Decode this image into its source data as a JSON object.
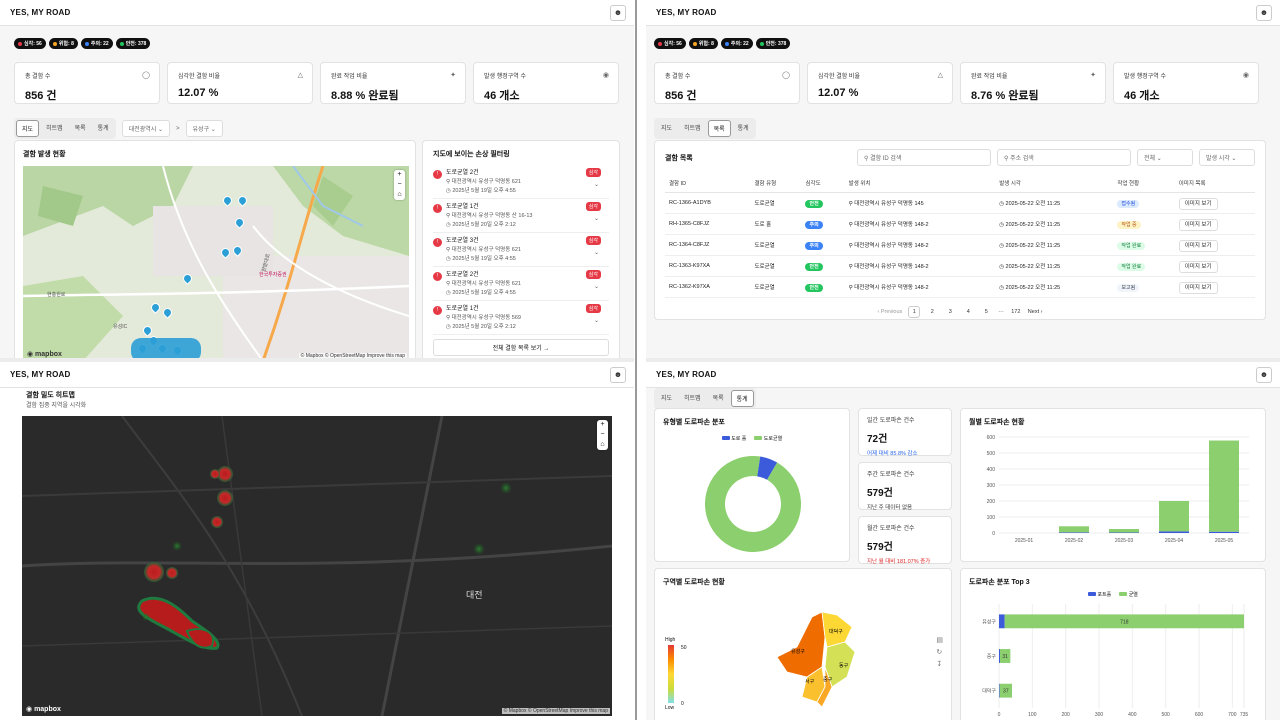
{
  "app": {
    "brand": "YES, MY ROAD"
  },
  "badges": [
    {
      "label": "심각: 56",
      "color": "#e63946"
    },
    {
      "label": "위험: 8",
      "color": "#f5a623"
    },
    {
      "label": "주의: 22",
      "color": "#3b82f6"
    },
    {
      "label": "안전: 378",
      "color": "#22c55e"
    }
  ],
  "q1": {
    "stats": [
      {
        "label": "총 결함 수",
        "value": "856 건",
        "icon": "message-icon"
      },
      {
        "label": "심각한 결함 비율",
        "value": "12.07 %",
        "icon": "alert-triangle-icon"
      },
      {
        "label": "완료 작업 비율",
        "value": "8.88 % 완료됨",
        "icon": "wrench-icon"
      },
      {
        "label": "발생 행정구역 수",
        "value": "46 개소",
        "icon": "map-pin-icon"
      }
    ],
    "tabs": [
      "지도",
      "히트맵",
      "목록",
      "통계"
    ],
    "city_select": "대전광역시",
    "district_select": "유성구",
    "sep": ">",
    "map_title": "결함 발생 현황",
    "map_labels": [
      "한국투자증권",
      "한밭대로",
      "현충원로",
      "유성IC"
    ],
    "filter_title": "지도에 보이는 손상 필터링",
    "filter_items": [
      {
        "title": "도로균열 2건",
        "addr": "대전광역시 유성구 덕명동 621",
        "date": "2025년 5월 19일 오후 4:55",
        "sev": "심각"
      },
      {
        "title": "도로균열 1건",
        "addr": "대전광역시 유성구 덕명동 산 16-13",
        "date": "2025년 5월 20일 오후 2:12",
        "sev": "심각"
      },
      {
        "title": "도로균열 3건",
        "addr": "대전광역시 유성구 덕명동 621",
        "date": "2025년 5월 19일 오후 4:55",
        "sev": "심각"
      },
      {
        "title": "도로균열 2건",
        "addr": "대전광역시 유성구 덕명동 621",
        "date": "2025년 5월 19일 오후 4:55",
        "sev": "심각"
      },
      {
        "title": "도로균열 1건",
        "addr": "대전광역시 유성구 덕명동 569",
        "date": "2025년 5월 20일 오후 2:12",
        "sev": "심각"
      }
    ],
    "view_all": "전체 결함 목록 보기"
  },
  "q2": {
    "stats": [
      {
        "label": "총 결함 수",
        "value": "856 건",
        "icon": "message-icon"
      },
      {
        "label": "심각한 결함 비율",
        "value": "12.07 %",
        "icon": "alert-triangle-icon"
      },
      {
        "label": "완료 작업 비율",
        "value": "8.76 % 완료됨",
        "icon": "wrench-icon"
      },
      {
        "label": "발생 행정구역 수",
        "value": "46 개소",
        "icon": "map-pin-icon"
      }
    ],
    "tabs": [
      "지도",
      "히트맵",
      "목록",
      "통계"
    ],
    "list_title": "결함 목록",
    "id_search_placeholder": "결함 ID 검색",
    "addr_search_placeholder": "주소 검색",
    "filter_all": "전체",
    "sort_select": "발생 시각",
    "columns": [
      "결함 ID",
      "결함 유형",
      "심각도",
      "발생 위치",
      "발생 시각",
      "작업 현황",
      "이미지 목록"
    ],
    "rows": [
      {
        "id": "RC-1366-A1DYB",
        "type": "도로균열",
        "sev": "안전",
        "sev_color": "#22c55e",
        "loc": "대전광역시 유성구 덕명동 145",
        "time": "2025-05-22 오전 11:25",
        "status": "접수됨",
        "st_bg": "#dbeafe",
        "st_fg": "#1d4ed8",
        "img": "이미지 보기"
      },
      {
        "id": "RH-1365-C8FJZ",
        "type": "도로 홀",
        "sev": "주의",
        "sev_color": "#3b82f6",
        "loc": "대전광역시 유성구 덕명동 148-2",
        "time": "2025-05-22 오전 11:25",
        "status": "작업 중",
        "st_bg": "#fef3c7",
        "st_fg": "#b45309",
        "img": "이미지 보기"
      },
      {
        "id": "RC-1364-C8FJZ",
        "type": "도로균열",
        "sev": "주의",
        "sev_color": "#3b82f6",
        "loc": "대전광역시 유성구 덕명동 148-2",
        "time": "2025-05-22 오전 11:25",
        "status": "작업 완료",
        "st_bg": "#dcfce7",
        "st_fg": "#15803d",
        "img": "이미지 보기"
      },
      {
        "id": "RC-1363-K97XA",
        "type": "도로균열",
        "sev": "안전",
        "sev_color": "#22c55e",
        "loc": "대전광역시 유성구 덕명동 148-2",
        "time": "2025-05-22 오전 11:25",
        "status": "작업 완료",
        "st_bg": "#dcfce7",
        "st_fg": "#15803d",
        "img": "이미지 보기"
      },
      {
        "id": "RC-1362-K97XA",
        "type": "도로균열",
        "sev": "안전",
        "sev_color": "#22c55e",
        "loc": "대전광역시 유성구 덕명동 148-2",
        "time": "2025-05-22 오전 11:25",
        "status": "보고됨",
        "st_bg": "#f1f5f9",
        "st_fg": "#334155",
        "img": "이미지 보기"
      }
    ],
    "pagination": {
      "prev": "Previous",
      "pages": [
        "1",
        "2",
        "3",
        "4",
        "5"
      ],
      "ellipsis": "···",
      "last": "172",
      "next": "Next"
    }
  },
  "q3": {
    "title": "결함 밀도 히트맵",
    "subtitle": "결함 집중 지역을 시각화",
    "city_label": "대전",
    "attr": "© Mapbox © OpenStreetMap Improve this map",
    "logo": "mapbox"
  },
  "q4": {
    "tabs": [
      "지도",
      "히트맵",
      "목록",
      "통계"
    ],
    "donut_title": "유형별 도로파손 분포",
    "donut_legend": [
      "도로 홀",
      "도로균열"
    ],
    "donut_colors": [
      "#3b5bdb",
      "#8ccf6e"
    ],
    "donut_values": [
      6,
      94
    ],
    "kpis": [
      {
        "label": "일간 도로파손 건수",
        "value": "72건",
        "note": "어제 대비 85.8% 감소",
        "note_color": "#2563eb"
      },
      {
        "label": "주간 도로파손 건수",
        "value": "579건",
        "note": "지난 주 데이터 없음",
        "note_color": "#333"
      },
      {
        "label": "월간 도로파손 건수",
        "value": "579건",
        "note": "지난 월 대비 181.07% 증가",
        "note_color": "#dc2626"
      }
    ],
    "bar_title": "월별 도로파손 현황",
    "region_title": "구역별 도로파손 현황",
    "legend_high": "High",
    "legend_low": "Low",
    "legend_max": "50",
    "legend_min": "0",
    "districts": [
      "유성구",
      "대덕구",
      "동구",
      "서구",
      "중구"
    ],
    "top3_title": "도로파손 분포 Top 3",
    "top3_legend": [
      "포트홀",
      "균열"
    ]
  },
  "chart_data": [
    {
      "type": "bar",
      "title": "월별 도로파손 현황",
      "categories": [
        "2025-01",
        "2025-02",
        "2025-03",
        "2025-04",
        "2025-05"
      ],
      "series": [
        {
          "name": "도로 홀",
          "values": [
            0,
            4,
            3,
            10,
            8
          ]
        },
        {
          "name": "도로균열",
          "values": [
            0,
            38,
            22,
            190,
            570
          ]
        }
      ],
      "ylim": [
        0,
        600
      ],
      "yticks": [
        "0",
        "100",
        "200",
        "300",
        "400",
        "500",
        "600"
      ]
    },
    {
      "type": "bar",
      "title": "도로파손 분포 Top 3",
      "orientation": "horizontal",
      "categories": [
        "유성구",
        "중구",
        "대덕구"
      ],
      "series": [
        {
          "name": "포트홀",
          "values": [
            17,
            3,
            2
          ]
        },
        {
          "name": "균열",
          "values": [
            718,
            31,
            37
          ]
        }
      ],
      "data_labels": [
        "718",
        "31",
        "37"
      ],
      "xticks": [
        "0",
        "100",
        "200",
        "300",
        "400",
        "500",
        "600",
        "700",
        "735"
      ],
      "xlim": [
        0,
        735
      ]
    }
  ]
}
